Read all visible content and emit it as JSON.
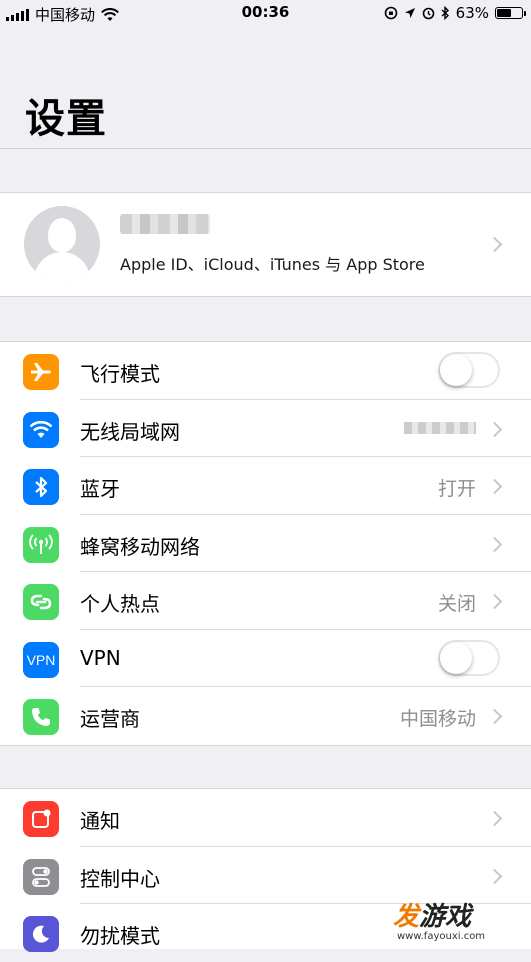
{
  "status_bar": {
    "carrier": "中国移动",
    "time": "00:36",
    "battery_percent_label": "63%",
    "battery_level": 0.63
  },
  "page": {
    "title": "设置"
  },
  "profile": {
    "subtitle": "Apple ID、iCloud、iTunes 与 App Store"
  },
  "group1": [
    {
      "label": "飞行模式",
      "icon": "airplane-icon",
      "color": "#ff9500",
      "control": "toggle",
      "on": false
    },
    {
      "label": "无线局域网",
      "icon": "wifi-icon",
      "color": "#007aff",
      "control": "chevron",
      "value_blurred": true
    },
    {
      "label": "蓝牙",
      "icon": "bluetooth-icon",
      "color": "#007aff",
      "control": "chevron",
      "value": "打开"
    },
    {
      "label": "蜂窝移动网络",
      "icon": "cellular-icon",
      "color": "#4cd964",
      "control": "chevron"
    },
    {
      "label": "个人热点",
      "icon": "hotspot-icon",
      "color": "#4cd964",
      "control": "chevron",
      "value": "关闭"
    },
    {
      "label": "VPN",
      "icon": "vpn-icon",
      "icon_text": "VPN",
      "color": "#007aff",
      "control": "toggle",
      "on": false
    },
    {
      "label": "运营商",
      "icon": "phone-icon",
      "color": "#4cd964",
      "control": "chevron",
      "value": "中国移动"
    }
  ],
  "group2": [
    {
      "label": "通知",
      "icon": "notifications-icon",
      "color": "#ff3b30"
    },
    {
      "label": "控制中心",
      "icon": "control-center-icon",
      "color": "#8e8e93"
    },
    {
      "label": "勿扰模式",
      "icon": "moon-icon",
      "color": "#5856d6"
    }
  ],
  "watermark": {
    "brand": "发游戏",
    "url": "www.fayouxi.com"
  }
}
